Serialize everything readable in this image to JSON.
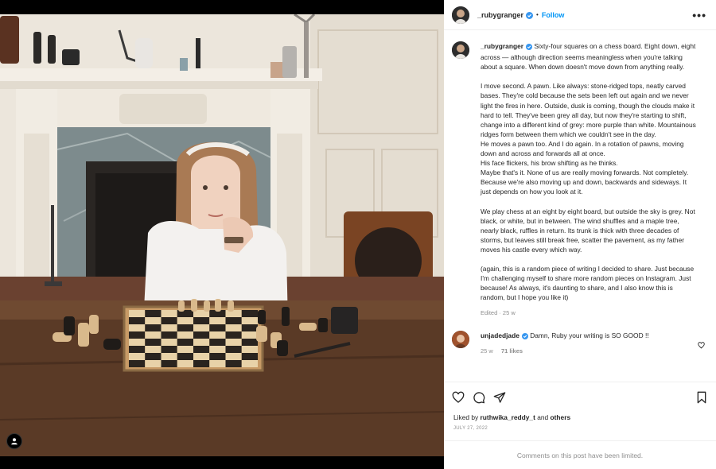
{
  "post": {
    "username": "_rubygranger",
    "follow_label": "Follow",
    "separator": "•",
    "more_label": "•••"
  },
  "caption": {
    "username": "_rubygranger",
    "paragraphs": [
      "Sixty-four squares on a chess board. Eight down, eight across — although direction seems meaningless when you're talking about a square. When down doesn't move down from anything really.",
      "I move second. A pawn. Like always: stone-ridged tops, neatly carved bases. They're cold because the sets been left out again and we never light the fires in here. Outside, dusk is coming, though the clouds make it hard to tell. They've been grey all day, but now they're starting to shift, change into a different kind of grey: more purple than white. Mountainous ridges form between them which we couldn't see in the day.\nHe moves a pawn too. And I do again. In a rotation of pawns, moving down and across and forwards all at once.\nHis face flickers, his brow shifting as he thinks.\nMaybe that's it. None of us are really moving forwards. Not completely. Because we're also moving up and down, backwards and sideways. It just depends on how you look at it.",
      "We play chess at an eight by eight board, but outside the sky is grey. Not black, or white, but in between. The wind shuffles and a maple tree, nearly black, ruffles in return. Its trunk is thick with three decades of storms, but leaves still break free, scatter the pavement, as my father moves his castle every which way.",
      "(again, this is a random piece of writing I decided to share. Just because I'm challenging myself to share more random pieces on Instagram. Just because! As always, it's daunting to share, and I also know this is random, but I hope you like it)"
    ],
    "meta": "Edited · 25 w"
  },
  "comment": {
    "username": "unjadedjade",
    "text": "Damn, Ruby your writing is SO GOOD !!",
    "time": "25 w",
    "likes": "71 likes"
  },
  "likes_line": {
    "prefix": "Liked by",
    "user": "ruthwika_reddy_t",
    "conjunction": "and",
    "others": "others"
  },
  "date": "JULY 27, 2022",
  "comments_limited": "Comments on this post have been limited.",
  "icons": {
    "verified": "verified-badge-icon",
    "more": "more-options-icon",
    "heart": "heart-icon",
    "comment": "comment-icon",
    "share": "share-icon",
    "bookmark": "bookmark-icon",
    "user_tag": "user-tag-icon"
  },
  "colors": {
    "accent": "#0095f6",
    "verified": "#3897f0",
    "muted": "#8e8e8e",
    "text": "#262626"
  }
}
